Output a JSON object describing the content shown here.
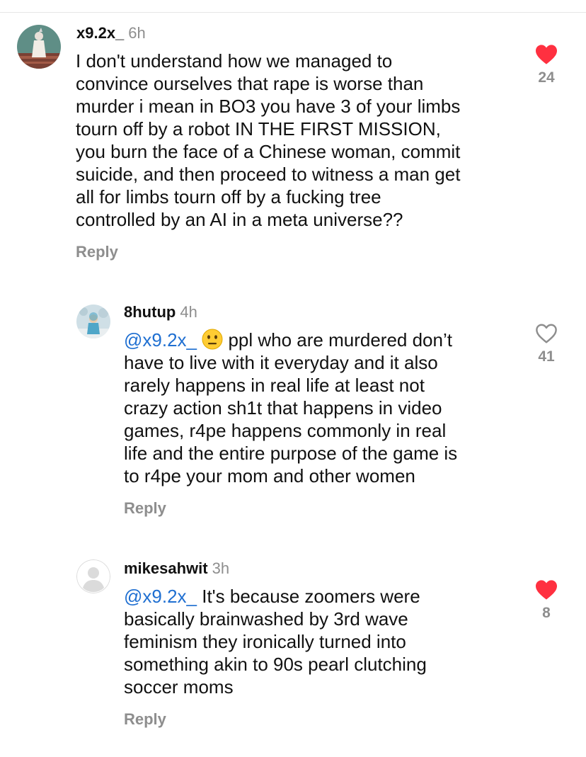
{
  "comments": [
    {
      "username": "x9.2x_",
      "time": "6h",
      "lines": [
        "I don't understand how we managed to",
        "convince ourselves that rape is worse than",
        "murder i mean in BO3 you have 3 of your limbs",
        "tourn off by a robot IN THE FIRST MISSION,",
        "you burn the face of a Chinese woman, commit",
        "suicide, and then proceed to witness a man get",
        "all for limbs tourn off by a fucking tree",
        "controlled by an AI in a meta universe??"
      ],
      "reply_label": "Reply",
      "likes": "24",
      "liked": true,
      "avatar_icon": "profile-photo"
    },
    {
      "username": "8hutup",
      "time": "4h",
      "mention": "@x9.2x_",
      "emoji": "neutral-face-emoji",
      "first_line_rest": " ppl who are murdered don’t",
      "lines": [
        "have to live with it everyday and it also",
        "rarely happens in real life at least not",
        "crazy action sh1t that happens in video",
        "games, r4pe happens commonly in real",
        "life and the entire purpose of the game is",
        "to r4pe your mom and other women"
      ],
      "reply_label": "Reply",
      "likes": "41",
      "liked": false,
      "avatar_icon": "profile-photo"
    },
    {
      "username": "mikesahwit",
      "time": "3h",
      "mention": "@x9.2x_",
      "first_line_rest": " It's because zoomers were",
      "lines": [
        "basically brainwashed by 3rd wave",
        "feminism they ironically turned into",
        "something akin to 90s pearl clutching",
        "soccer moms"
      ],
      "reply_label": "Reply",
      "likes": "8",
      "liked": true,
      "avatar_icon": "default-avatar-icon"
    }
  ],
  "colors": {
    "heart_red": "#ff3040",
    "mention_blue": "#1f6fd1",
    "muted_gray": "#8e8e8e"
  }
}
